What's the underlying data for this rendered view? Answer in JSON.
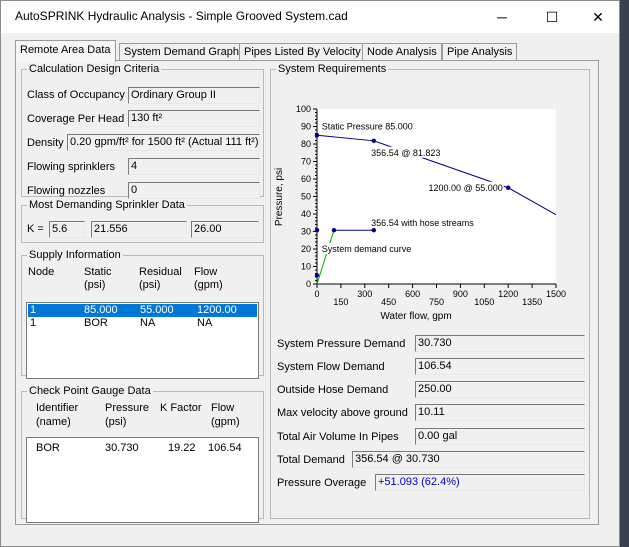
{
  "window": {
    "title": "AutoSPRINK Hydraulic Analysis - Simple Grooved System.cad"
  },
  "tabs": [
    "Remote Area Data",
    "System Demand Graph",
    "Pipes Listed By Velocity",
    "Node Analysis",
    "Pipe Analysis"
  ],
  "calc": {
    "legend": "Calculation Design Criteria",
    "occupancy_label": "Class of Occupancy",
    "occupancy_value": "Ordinary Group II",
    "coverage_label": "Coverage Per Head",
    "coverage_value": "130 ft²",
    "density_label": "Density",
    "density_value": "0.20 gpm/ft² for 1500 ft² (Actual 111 ft²)",
    "flowing_sprinklers_label": "Flowing sprinklers",
    "flowing_sprinklers_value": "4",
    "flowing_nozzles_label": "Flowing nozzles",
    "flowing_nozzles_value": "0"
  },
  "demanding": {
    "legend": "Most Demanding Sprinkler Data",
    "k_label": "K =",
    "k_value": "5.6",
    "flow": "21.556",
    "pressure": "26.00"
  },
  "supply": {
    "legend": "Supply Information",
    "headers": {
      "node": "Node",
      "static": "Static",
      "static_unit": "(psi)",
      "residual": "Residual",
      "residual_unit": "(psi)",
      "flow": "Flow",
      "flow_unit": "(gpm)"
    },
    "rows": [
      {
        "node": "1",
        "static": "85.000",
        "residual": "55.000",
        "flow": "1200.00"
      },
      {
        "node": "1",
        "static": "BOR",
        "residual": "NA",
        "flow": "NA"
      }
    ]
  },
  "gauge": {
    "legend": "Check Point Gauge Data",
    "headers": {
      "id": "Identifier",
      "id_unit": "(name)",
      "pressure": "Pressure",
      "pressure_unit": "(psi)",
      "kfactor": "K Factor",
      "flow": "Flow",
      "flow_unit": "(gpm)"
    },
    "rows": [
      {
        "id": "BOR",
        "pressure": "30.730",
        "kfactor": "19.22",
        "flow": "106.54"
      }
    ]
  },
  "sysreq": {
    "legend": "System Requirements",
    "fields": [
      {
        "label": "System Pressure Demand",
        "value": "30.730"
      },
      {
        "label": "System Flow Demand",
        "value": "106.54"
      },
      {
        "label": "Outside Hose Demand",
        "value": "250.00"
      },
      {
        "label": "Max velocity above ground",
        "value": "10.11"
      },
      {
        "label": "Total Air Volume In Pipes",
        "value": "0.00 gal"
      },
      {
        "label": "Total Demand",
        "value": "356.54 @ 30.730"
      },
      {
        "label": "Pressure Overage",
        "value": "+51.093 (62.4%)"
      }
    ],
    "overage_color": "#0000cc"
  },
  "chart_data": {
    "type": "line",
    "xlabel": "Water flow, gpm",
    "ylabel": "Pressure, psi",
    "xlim": [
      0,
      1500
    ],
    "ylim": [
      0,
      100
    ],
    "x_ticks": [
      "0",
      "150",
      "300",
      "450",
      "600",
      "750",
      "900",
      "1050",
      "1200",
      "1350",
      "1500"
    ],
    "y_ticks": [
      "0",
      "10",
      "20",
      "30",
      "40",
      "50",
      "60",
      "70",
      "80",
      "90",
      "100"
    ],
    "supply_curve": {
      "color": "#00008b",
      "points": [
        [
          0,
          85
        ],
        [
          356.54,
          81.823
        ],
        [
          1200,
          55
        ],
        [
          1500,
          39.6
        ]
      ]
    },
    "demand_curve": {
      "color": "#00aa00",
      "points": [
        [
          0,
          0
        ],
        [
          106.54,
          30.73
        ]
      ]
    },
    "hose_line": {
      "color": "#00008b",
      "points": [
        [
          106.54,
          30.73
        ],
        [
          356.54,
          30.73
        ]
      ]
    },
    "points": [
      [
        0,
        85
      ],
      [
        356.54,
        81.823
      ],
      [
        1200,
        55
      ],
      [
        106.54,
        30.73
      ],
      [
        356.54,
        30.73
      ],
      [
        0,
        30.73
      ],
      [
        0,
        5
      ]
    ],
    "annotations": [
      {
        "text": "Static Pressure 85.000",
        "x": 30,
        "y": 90
      },
      {
        "text": "356.54 @ 81.823",
        "x": 340,
        "y": 75
      },
      {
        "text": "1200.00 @ 55.000",
        "x": 700,
        "y": 55
      },
      {
        "text": "356.54 with hose streams",
        "x": 340,
        "y": 35
      },
      {
        "text": "System demand curve",
        "x": 30,
        "y": 20
      }
    ],
    "grid": false
  }
}
